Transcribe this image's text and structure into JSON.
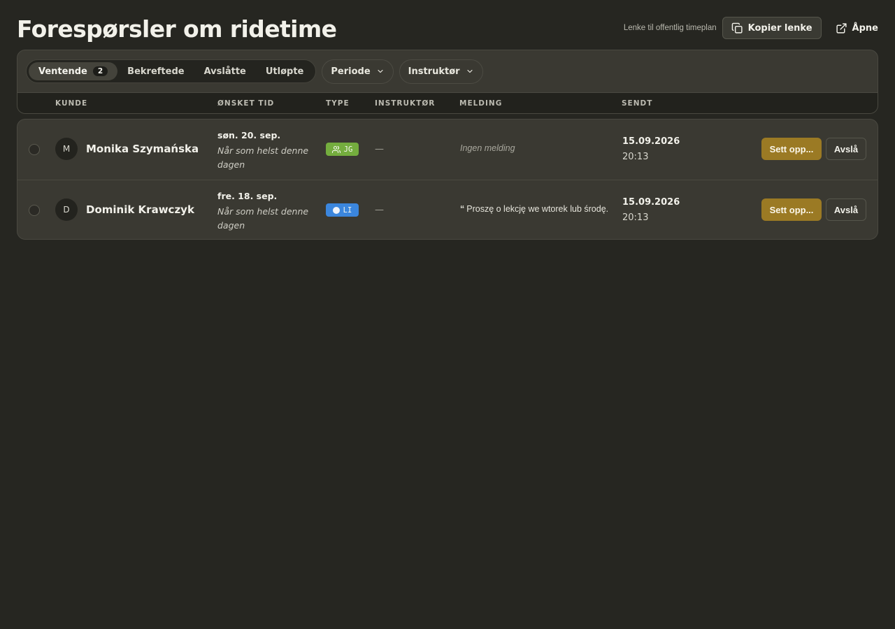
{
  "header": {
    "title": "Forespørsler om ridetime",
    "public_link_label": "Lenke til offentlig timeplan",
    "copy_link_label": "Kopier lenke",
    "open_label": "Åpne"
  },
  "filters": {
    "tabs": [
      {
        "label": "Ventende",
        "count": "2",
        "active": true
      },
      {
        "label": "Bekreftede"
      },
      {
        "label": "Avslåtte"
      },
      {
        "label": "Utløpte"
      }
    ],
    "period_label": "Periode",
    "instructor_label": "Instruktør"
  },
  "table": {
    "columns": [
      "KUNDE",
      "ØNSKET TID",
      "TYPE",
      "INSTRUKTØR",
      "MELDING",
      "SENDT"
    ],
    "rows": [
      {
        "initial": "M",
        "name": "Monika Szymańska",
        "date": "søn. 20. sep.",
        "time_note": "Når som helst denne dagen",
        "type_code": "JG",
        "type_icon": "users-icon",
        "type_color": "#74ad3e",
        "instructor": "—",
        "message": "Ingen melding",
        "sent_date": "15.09.2026",
        "sent_time": "20:13",
        "setup_label": "Sett opp...",
        "reject_label": "Avslå"
      },
      {
        "initial": "D",
        "name": "Dominik Krawczyk",
        "date": "fre. 18. sep.",
        "time_note": "Når som helst denne dagen",
        "type_code": "LI",
        "type_icon": "circle-icon",
        "type_color": "#3b86dd",
        "instructor": "—",
        "quote_mark": "“",
        "message": "Proszę o lekcję we wtorek lub środę.",
        "sent_date": "15.09.2026",
        "sent_time": "20:13",
        "setup_label": "Sett opp...",
        "reject_label": "Avslå"
      }
    ]
  },
  "colors": {
    "background": "#262621",
    "panel": "#3a3932",
    "accent": "#9b7a24"
  }
}
